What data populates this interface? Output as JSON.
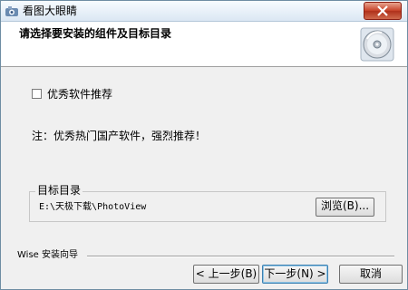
{
  "window": {
    "title": "看图大眼睛",
    "close_icon": "close-icon",
    "app_icon": "app-icon"
  },
  "header": {
    "title": "请选择要安装的组件及目标目录",
    "icon": "cd-disc-icon"
  },
  "components": {
    "checkbox_label": "优秀软件推荐",
    "checked": false
  },
  "note": "注：优秀热门国产软件，强烈推荐！",
  "target": {
    "group_title": "目标目录",
    "path": "E:\\天极下载\\PhotoView",
    "browse_label": "浏览(B)..."
  },
  "footer": {
    "brand": "Wise 安装向导",
    "back_label": "< 上一步(B)",
    "next_label": "下一步(N) >",
    "cancel_label": "取消"
  },
  "colors": {
    "accent": "#3c7fb1",
    "close_button": "#c8442b"
  }
}
